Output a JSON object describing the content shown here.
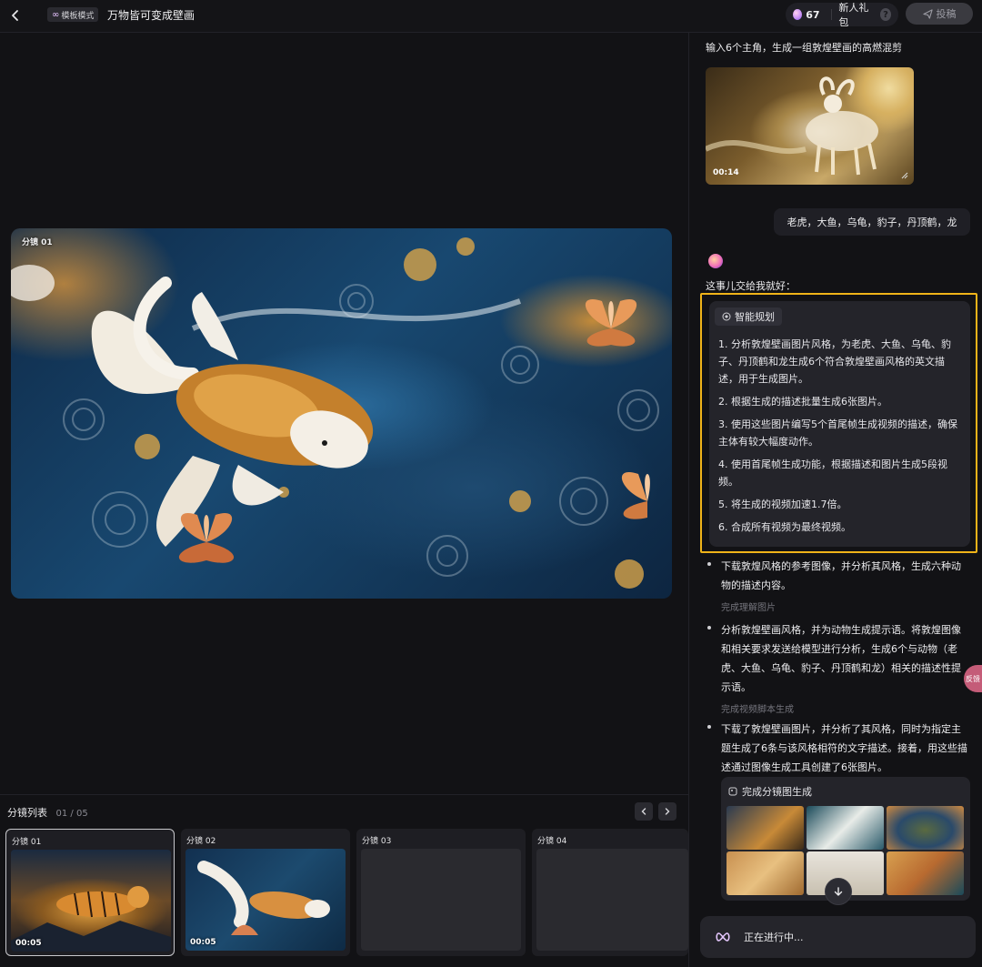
{
  "header": {
    "mode_label": "模板模式",
    "title": "万物皆可变成壁画",
    "credits": "67",
    "gift_label": "新人礼包",
    "help": "?",
    "submit_label": "投稿"
  },
  "preview": {
    "label": "分镜 01"
  },
  "storyboard": {
    "title": "分镜列表",
    "count": "01 / 05",
    "cards": [
      {
        "label": "分镜 01",
        "duration": "00:05"
      },
      {
        "label": "分镜 02",
        "duration": "00:05"
      },
      {
        "label": "分镜 03",
        "duration": ""
      },
      {
        "label": "分镜 04",
        "duration": ""
      }
    ]
  },
  "chat": {
    "prompt": "输入6个主角，生成一组敦煌壁画的高燃混剪",
    "video_duration": "00:14",
    "user_message": "老虎，大鱼，乌龟，豹子，丹顶鹤，龙",
    "ai_intro": "这事儿交给我就好：",
    "plan_tag": "智能规划",
    "plan_items": [
      "1. 分析敦煌壁画图片风格，为老虎、大鱼、乌龟、豹子、丹顶鹤和龙生成6个符合敦煌壁画风格的英文描述，用于生成图片。",
      "2. 根据生成的描述批量生成6张图片。",
      "3. 使用这些图片编写5个首尾帧生成视频的描述，确保主体有较大幅度动作。",
      "4. 使用首尾帧生成功能，根据描述和图片生成5段视频。",
      "5. 将生成的视频加速1.7倍。",
      "6. 合成所有视频为最终视频。"
    ],
    "steps": [
      {
        "text": "下载敦煌风格的参考图像，并分析其风格，生成六种动物的描述内容。",
        "status": "完成理解图片"
      },
      {
        "text": "分析敦煌壁画风格，并为动物生成提示语。将敦煌图像和相关要求发送给模型进行分析，生成6个与动物（老虎、大鱼、乌龟、豹子、丹顶鹤和龙）相关的描述性提示语。",
        "status": "完成视频脚本生成"
      },
      {
        "text": "下载了敦煌壁画图片，并分析了其风格，同时为指定主题生成了6条与该风格相符的文字描述。接着，用这些描述通过图像生成工具创建了6张图片。",
        "status": ""
      }
    ],
    "gen_tag": "完成分镜图生成",
    "side_float": "反馈",
    "progress_label": "正在进行中..."
  },
  "colors": {
    "highlight_border": "#f0b419",
    "background": "#121215",
    "panel": "#24242a"
  }
}
